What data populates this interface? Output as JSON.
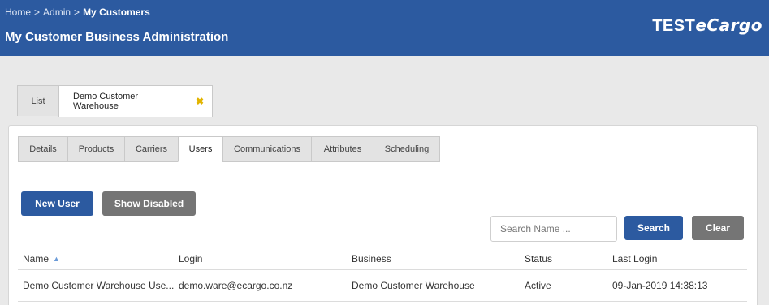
{
  "breadcrumb": {
    "items": [
      "Home",
      "Admin",
      "My Customers"
    ],
    "separator": ">"
  },
  "header": {
    "title": "My Customer Business Administration",
    "brand_a": "TEST",
    "brand_b": "eCargo"
  },
  "top_tabs": {
    "list_label": "List",
    "customer_label": "Demo Customer Warehouse",
    "close_glyph": "✖"
  },
  "sub_tabs": [
    "Details",
    "Products",
    "Carriers",
    "Users",
    "Communications",
    "Attributes",
    "Scheduling"
  ],
  "active_sub_tab": "Users",
  "actions": {
    "new_user": "New User",
    "show_disabled": "Show Disabled"
  },
  "search": {
    "placeholder": "Search Name ...",
    "value": "",
    "search_label": "Search",
    "clear_label": "Clear"
  },
  "table": {
    "columns": [
      "Name",
      "Login",
      "Business",
      "Status",
      "Last Login"
    ],
    "sort_icon": "▲",
    "rows": [
      [
        "Demo Customer Warehouse Use...",
        "demo.ware@ecargo.co.nz",
        "Demo Customer Warehouse",
        "Active",
        "09-Jan-2019 14:38:13"
      ]
    ]
  },
  "colors": {
    "header_bg": "#2c5aa0",
    "primary_button": "#2c5aa0",
    "secondary_button": "#757575",
    "close_icon": "#e2b400",
    "page_bg": "#e9e9e9"
  },
  "icons": {
    "close_tab": "close-icon",
    "sort": "sort-asc-icon"
  }
}
